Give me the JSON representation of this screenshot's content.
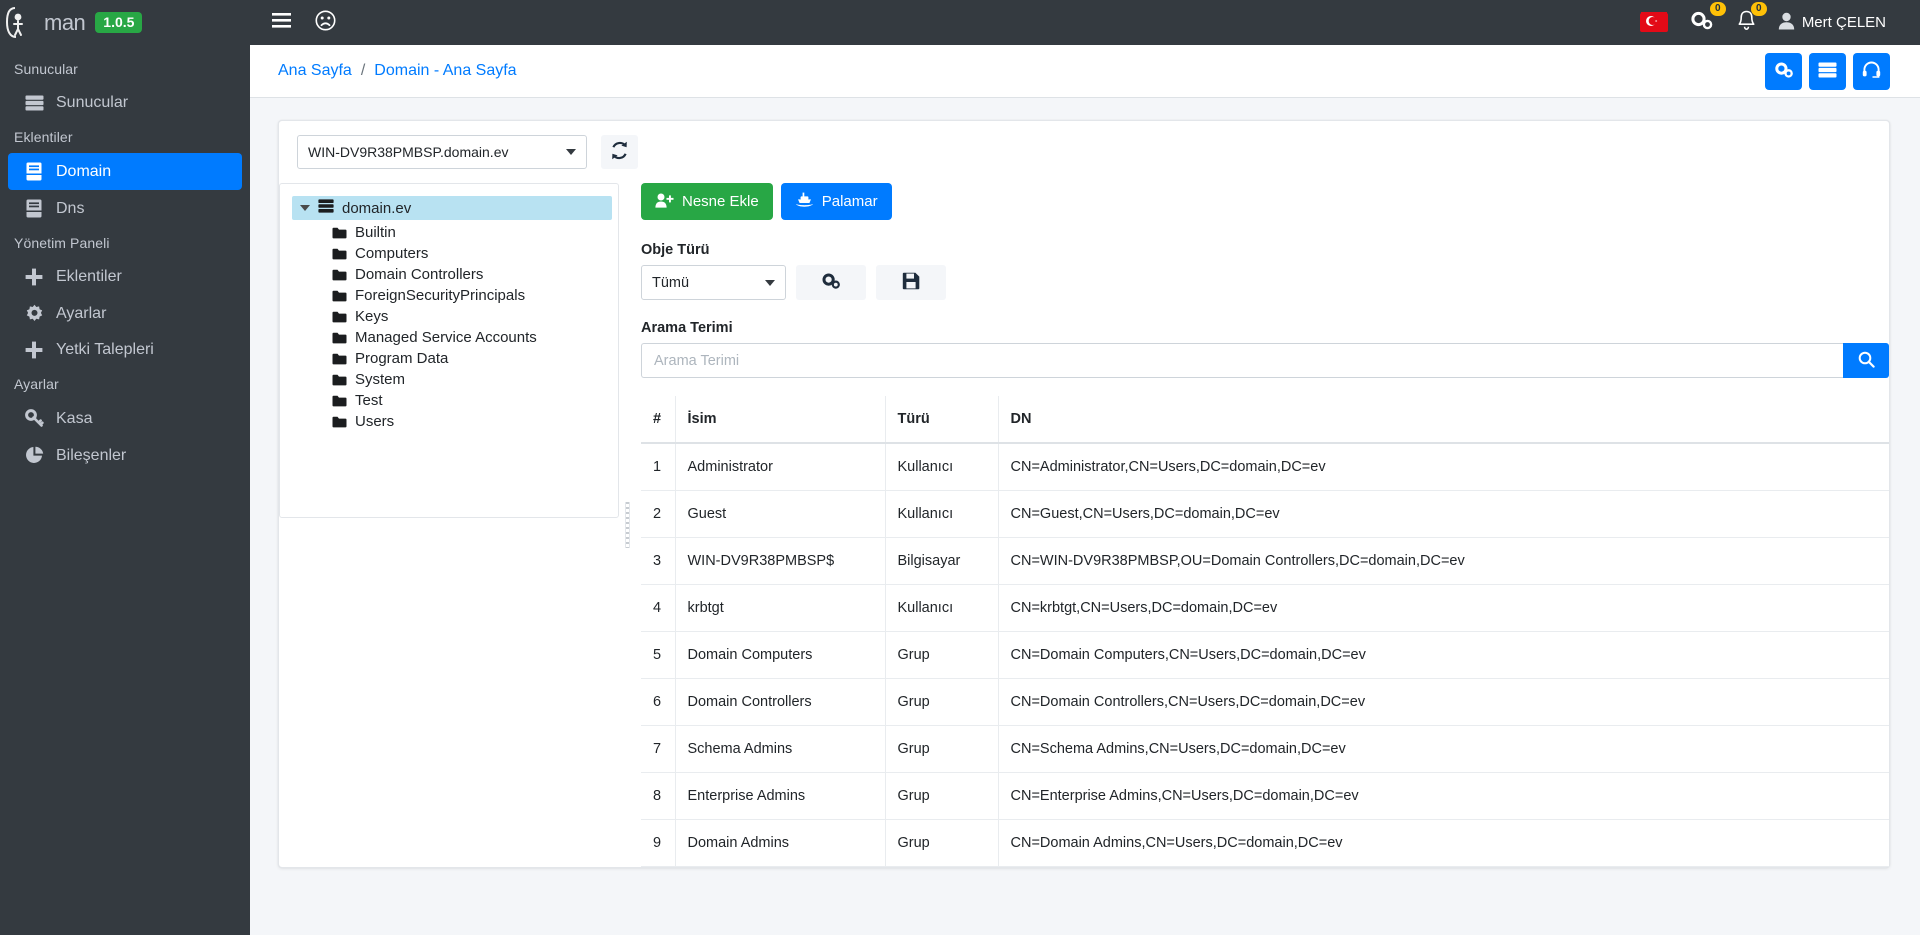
{
  "navbar": {
    "brand_text": "man",
    "version": "1.0.5",
    "menu_toggle_icon": "hamburger-icon",
    "circle_icon": "frowning-face-circle-icon",
    "language_flag": "turkish-flag-icon",
    "gears_badge": "0",
    "bell_badge": "0",
    "user_name": "Mert ÇELEN"
  },
  "sidebar": {
    "groups": [
      {
        "header": "Sunucular",
        "items": [
          {
            "label": "Sunucular",
            "icon": "server-icon",
            "active": false
          }
        ]
      },
      {
        "header": "Eklentiler",
        "items": [
          {
            "label": "Domain",
            "icon": "book-icon",
            "active": true
          },
          {
            "label": "Dns",
            "icon": "book-icon",
            "active": false
          }
        ]
      },
      {
        "header": "Yönetim Paneli",
        "items": [
          {
            "label": "Eklentiler",
            "icon": "plus-icon",
            "active": false
          },
          {
            "label": "Ayarlar",
            "icon": "gear-icon",
            "active": false
          },
          {
            "label": "Yetki Talepleri",
            "icon": "plus-icon",
            "active": false
          }
        ]
      },
      {
        "header": "Ayarlar",
        "items": [
          {
            "label": "Kasa",
            "icon": "key-icon",
            "active": false
          },
          {
            "label": "Bileşenler",
            "icon": "pie-chart-icon",
            "active": false
          }
        ]
      }
    ]
  },
  "header": {
    "breadcrumb": [
      {
        "label": "Ana Sayfa"
      },
      {
        "label": "Domain - Ana Sayfa"
      }
    ],
    "separator": "/",
    "actions": [
      {
        "name": "gears-button",
        "icon": "gears-icon"
      },
      {
        "name": "servers-button",
        "icon": "server-list-icon"
      },
      {
        "name": "support-button",
        "icon": "headset-icon"
      }
    ]
  },
  "main": {
    "domain_select": {
      "value": "WIN-DV9R38PMBSP.domain.ev"
    },
    "refresh_icon": "refresh-icon",
    "tree": {
      "root": {
        "label": "domain.ev",
        "icon": "server-icon",
        "expanded": true
      },
      "children": [
        {
          "label": "Builtin",
          "icon": "folder-icon"
        },
        {
          "label": "Computers",
          "icon": "folder-icon"
        },
        {
          "label": "Domain Controllers",
          "icon": "folder-icon"
        },
        {
          "label": "ForeignSecurityPrincipals",
          "icon": "folder-icon"
        },
        {
          "label": "Keys",
          "icon": "folder-icon"
        },
        {
          "label": "Managed Service Accounts",
          "icon": "folder-icon"
        },
        {
          "label": "Program Data",
          "icon": "folder-icon"
        },
        {
          "label": "System",
          "icon": "folder-icon"
        },
        {
          "label": "Test",
          "icon": "folder-icon"
        },
        {
          "label": "Users",
          "icon": "folder-icon"
        }
      ]
    },
    "actions": {
      "add_object": {
        "label": "Nesne Ekle",
        "icon": "user-plus-icon",
        "color": "#28a745"
      },
      "palamar": {
        "label": "Palamar",
        "icon": "ship-icon",
        "color": "#007bff"
      }
    },
    "object_type": {
      "label": "Obje Türü",
      "value": "Tümü",
      "settings_icon": "gears-icon",
      "save_icon": "floppy-disk-icon"
    },
    "search": {
      "label": "Arama Terimi",
      "value": "",
      "placeholder": "Arama Terimi",
      "button_icon": "search-icon"
    },
    "table": {
      "columns": [
        "#",
        "İsim",
        "Türü",
        "DN"
      ],
      "rows": [
        {
          "num": "1",
          "name": "Administrator",
          "type": "Kullanıcı",
          "dn": "CN=Administrator,CN=Users,DC=domain,DC=ev"
        },
        {
          "num": "2",
          "name": "Guest",
          "type": "Kullanıcı",
          "dn": "CN=Guest,CN=Users,DC=domain,DC=ev"
        },
        {
          "num": "3",
          "name": "WIN-DV9R38PMBSP$",
          "type": "Bilgisayar",
          "dn": "CN=WIN-DV9R38PMBSP,OU=Domain Controllers,DC=domain,DC=ev"
        },
        {
          "num": "4",
          "name": "krbtgt",
          "type": "Kullanıcı",
          "dn": "CN=krbtgt,CN=Users,DC=domain,DC=ev"
        },
        {
          "num": "5",
          "name": "Domain Computers",
          "type": "Grup",
          "dn": "CN=Domain Computers,CN=Users,DC=domain,DC=ev"
        },
        {
          "num": "6",
          "name": "Domain Controllers",
          "type": "Grup",
          "dn": "CN=Domain Controllers,CN=Users,DC=domain,DC=ev"
        },
        {
          "num": "7",
          "name": "Schema Admins",
          "type": "Grup",
          "dn": "CN=Schema Admins,CN=Users,DC=domain,DC=ev"
        },
        {
          "num": "8",
          "name": "Enterprise Admins",
          "type": "Grup",
          "dn": "CN=Enterprise Admins,CN=Users,DC=domain,DC=ev"
        },
        {
          "num": "9",
          "name": "Domain Admins",
          "type": "Grup",
          "dn": "CN=Domain Admins,CN=Users,DC=domain,DC=ev"
        }
      ]
    }
  },
  "colors": {
    "sidebar_bg": "#343a40",
    "accent_blue": "#007bff",
    "accent_green": "#28a745",
    "badge_yellow": "#ffc107",
    "tree_selected": "#b8e2f2"
  }
}
